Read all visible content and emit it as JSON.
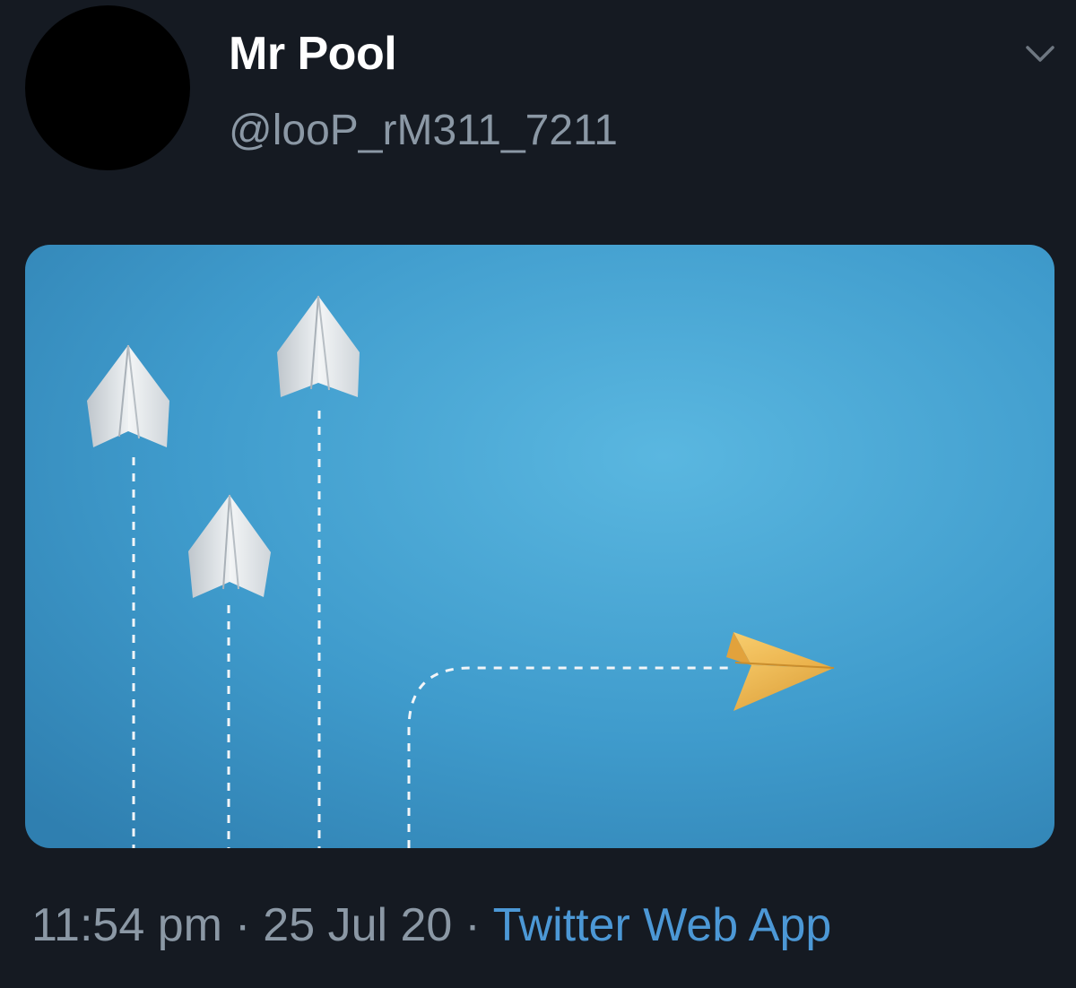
{
  "tweet": {
    "display_name": "Mr Pool",
    "handle": "@looP_rM311_7211",
    "time": "11:54 pm",
    "date": "25 Jul 20",
    "source": "Twitter Web App",
    "separator": "·",
    "menu_icon": "chevron-down-icon",
    "media": {
      "description_icon": "paper-planes-image",
      "background_color": "#3f9bcc",
      "plane_white_color": "#e6e9ec",
      "plane_gold_color": "#f2bc55"
    }
  },
  "colors": {
    "background": "#151a22",
    "secondary_text": "#8b98a5",
    "link": "#4c98d6"
  }
}
